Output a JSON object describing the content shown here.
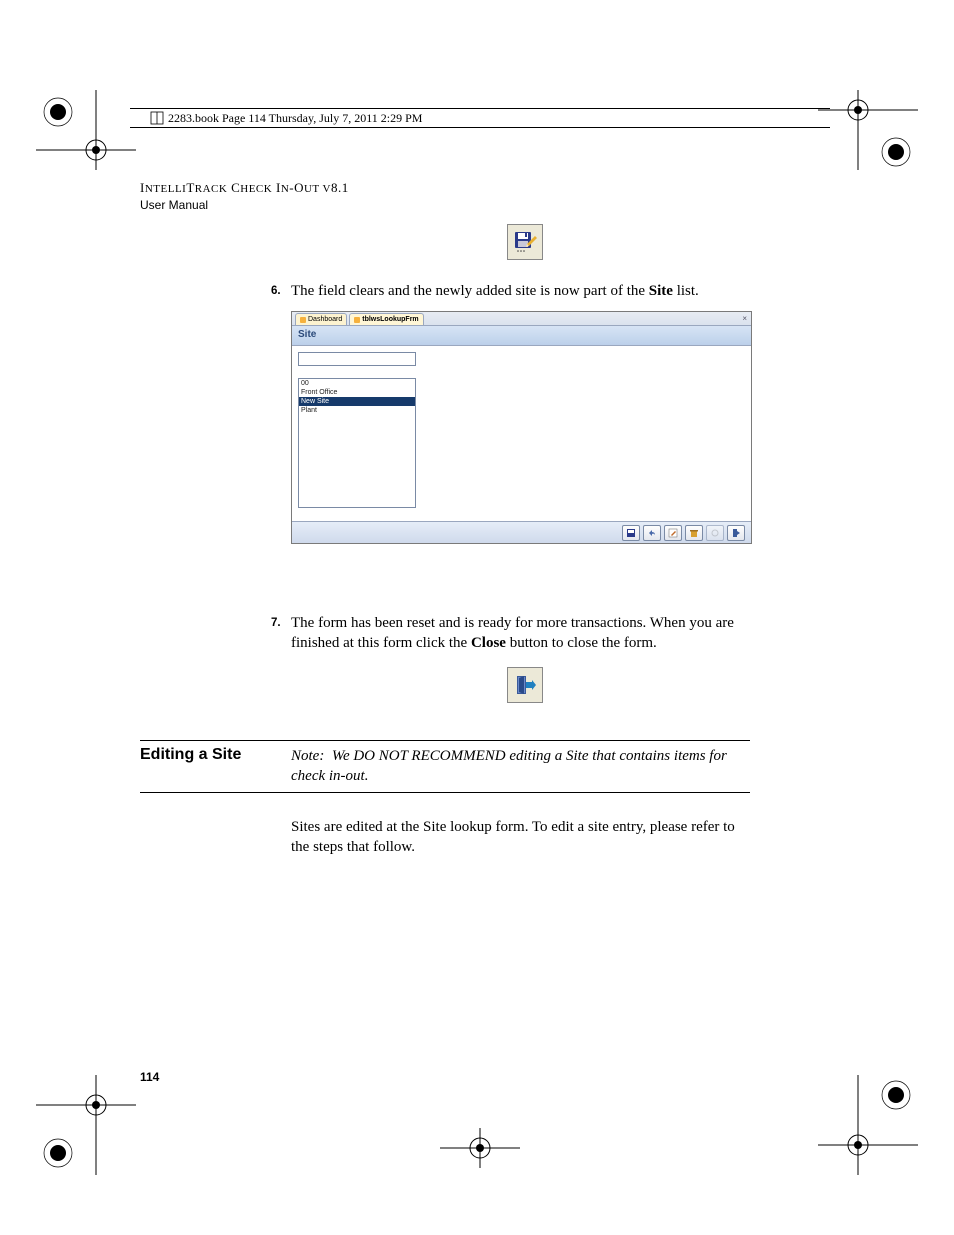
{
  "header": {
    "running_line": "2283.book  Page 114  Thursday, July 7, 2011  2:29 PM",
    "product_line1": "IntelliTrack Check In-Out v8.1",
    "product_line2": "User Manual"
  },
  "steps": {
    "s6_num": "6.",
    "s6_text_a": "The field clears and the newly added site is now part of the ",
    "s6_text_bold": "Site",
    "s6_text_b": " list.",
    "s7_num": "7.",
    "s7_text_a": "The form has been reset and is ready for more transactions. When you are finished at this form click the ",
    "s7_text_bold": "Close",
    "s7_text_b": " button to close the form."
  },
  "screenshot": {
    "tab1": "Dashboard",
    "tab2": "tblwsLookupFrm",
    "title": "Site",
    "rows": [
      "00",
      "Front Office",
      "New Site",
      "Plant"
    ],
    "selected_index": 2
  },
  "section": {
    "heading": "Editing a Site",
    "note_label": "Note:",
    "note_body": "We DO NOT RECOMMEND editing a Site that contains items for check in-out.",
    "para": "Sites are edited at the Site lookup form. To edit a site entry, please refer to the steps that follow."
  },
  "page_number": "114"
}
